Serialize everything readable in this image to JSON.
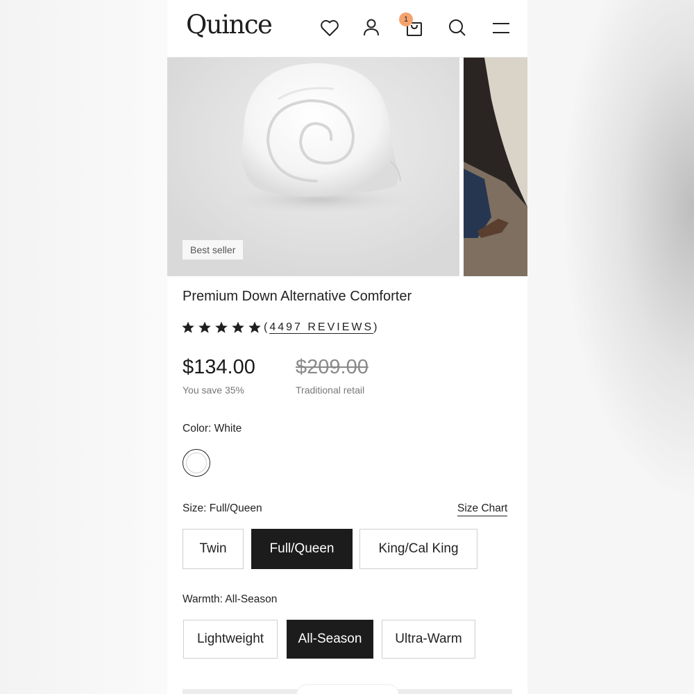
{
  "header": {
    "logo": "Quince",
    "cart_count": "1",
    "icons": [
      "heart-icon",
      "user-icon",
      "cart-icon",
      "search-icon",
      "menu-icon"
    ]
  },
  "gallery": {
    "badge": "Best seller"
  },
  "product": {
    "title": "Premium Down Alternative Comforter",
    "rating_stars": 5,
    "reviews_open": "(",
    "reviews_label": "4497 REVIEWS",
    "reviews_close": ")",
    "price": "$134.00",
    "savings": "You save 35%",
    "retail_price": "$209.00",
    "retail_label": "Traditional retail"
  },
  "color": {
    "label": "Color: White",
    "selected_swatch": "#ffffff"
  },
  "size": {
    "label": "Size: Full/Queen",
    "chart_link": "Size Chart",
    "options": [
      "Twin",
      "Full/Queen",
      "King/Cal King"
    ],
    "selected": "Full/Queen"
  },
  "warmth": {
    "label": "Warmth: All-Season",
    "options": [
      "Lightweight",
      "All-Season",
      "Ultra-Warm"
    ],
    "selected": "All-Season"
  },
  "colors": {
    "accent_dark": "#1c1c1c",
    "badge_orange": "#f4a26e",
    "muted_text": "#777777"
  }
}
